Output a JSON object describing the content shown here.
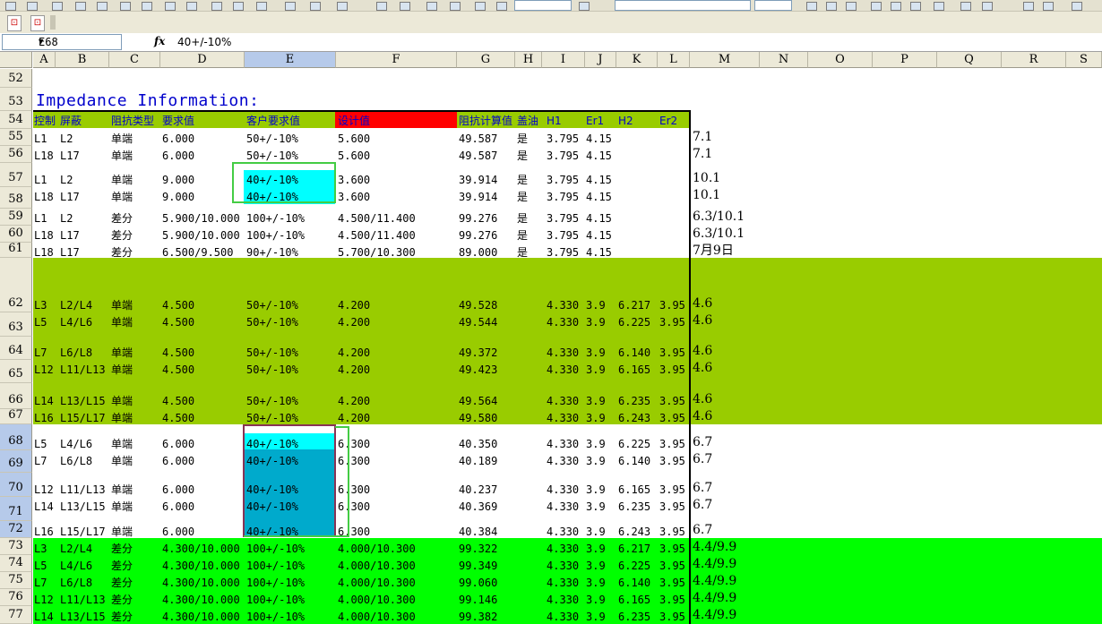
{
  "name_box": "E68",
  "formula_bar": "40+/-10%",
  "columns": [
    "A",
    "B",
    "C",
    "D",
    "E",
    "F",
    "G",
    "H",
    "I",
    "J",
    "K",
    "L",
    "M",
    "N",
    "O",
    "P",
    "Q",
    "R",
    "S"
  ],
  "rows": [
    "52",
    "53",
    "54",
    "55",
    "56",
    "57",
    "58",
    "59",
    "60",
    "61",
    "62",
    "63",
    "64",
    "65",
    "66",
    "67",
    "68",
    "69",
    "70",
    "71",
    "72",
    "73",
    "74",
    "75",
    "76",
    "77"
  ],
  "title": "Impedance Information:",
  "header": {
    "control": "控制",
    "shield": "屏蔽",
    "type": "阻抗类型",
    "requirement": "要求值",
    "customer": "客户要求值",
    "design": "设计值",
    "calc": "阻抗计算值",
    "oil": "盖油",
    "h1": "H1",
    "er1": "Er1",
    "h2": "H2",
    "er2": "Er2"
  },
  "data_rows": [
    {
      "row": "55",
      "a": "L1",
      "b": "L2",
      "c": "单端",
      "d": "6.000",
      "e": "50+/-10%",
      "f": "5.600",
      "g": "49.587",
      "h": "是",
      "i": "3.795",
      "j": "4.15",
      "k": "",
      "l": "",
      "m": "7.1"
    },
    {
      "row": "56",
      "a": "L18",
      "b": "L17",
      "c": "单端",
      "d": "6.000",
      "e": "50+/-10%",
      "f": "5.600",
      "g": "49.587",
      "h": "是",
      "i": "3.795",
      "j": "4.15",
      "k": "",
      "l": "",
      "m": "7.1"
    },
    {
      "row": "57",
      "a": "L1",
      "b": "L2",
      "c": "单端",
      "d": "9.000",
      "e": "40+/-10%",
      "f": "3.600",
      "g": "39.914",
      "h": "是",
      "i": "3.795",
      "j": "4.15",
      "k": "",
      "l": "",
      "m": "10.1"
    },
    {
      "row": "58",
      "a": "L18",
      "b": "L17",
      "c": "单端",
      "d": "9.000",
      "e": "40+/-10%",
      "f": "3.600",
      "g": "39.914",
      "h": "是",
      "i": "3.795",
      "j": "4.15",
      "k": "",
      "l": "",
      "m": "10.1"
    },
    {
      "row": "59",
      "a": "L1",
      "b": "L2",
      "c": "差分",
      "d": "5.900/10.000",
      "e": "100+/-10%",
      "f": "4.500/11.400",
      "g": "99.276",
      "h": "是",
      "i": "3.795",
      "j": "4.15",
      "k": "",
      "l": "",
      "m": "6.3/10.1"
    },
    {
      "row": "60",
      "a": "L18",
      "b": "L17",
      "c": "差分",
      "d": "5.900/10.000",
      "e": "100+/-10%",
      "f": "4.500/11.400",
      "g": "99.276",
      "h": "是",
      "i": "3.795",
      "j": "4.15",
      "k": "",
      "l": "",
      "m": "6.3/10.1"
    },
    {
      "row": "61",
      "a": "L18",
      "b": "L17",
      "c": "差分",
      "d": "6.500/9.500",
      "e": "90+/-10%",
      "f": "5.700/10.300",
      "g": "89.000",
      "h": "是",
      "i": "3.795",
      "j": "4.15",
      "k": "",
      "l": "",
      "m": "7月9日"
    },
    {
      "row": "62",
      "a": "L3",
      "b": "L2/L4",
      "c": "单端",
      "d": "4.500",
      "e": "50+/-10%",
      "f": "4.200",
      "g": "49.528",
      "h": "",
      "i": "4.330",
      "j": "3.9",
      "k": "6.217",
      "l": "3.95",
      "m": "4.6"
    },
    {
      "row": "63",
      "a": "L5",
      "b": "L4/L6",
      "c": "单端",
      "d": "4.500",
      "e": "50+/-10%",
      "f": "4.200",
      "g": "49.544",
      "h": "",
      "i": "4.330",
      "j": "3.9",
      "k": "6.225",
      "l": "3.95",
      "m": "4.6"
    },
    {
      "row": "64",
      "a": "L7",
      "b": "L6/L8",
      "c": "单端",
      "d": "4.500",
      "e": "50+/-10%",
      "f": "4.200",
      "g": "49.372",
      "h": "",
      "i": "4.330",
      "j": "3.9",
      "k": "6.140",
      "l": "3.95",
      "m": "4.6"
    },
    {
      "row": "65",
      "a": "L12",
      "b": "L11/L13",
      "c": "单端",
      "d": "4.500",
      "e": "50+/-10%",
      "f": "4.200",
      "g": "49.423",
      "h": "",
      "i": "4.330",
      "j": "3.9",
      "k": "6.165",
      "l": "3.95",
      "m": "4.6"
    },
    {
      "row": "66",
      "a": "L14",
      "b": "L13/L15",
      "c": "单端",
      "d": "4.500",
      "e": "50+/-10%",
      "f": "4.200",
      "g": "49.564",
      "h": "",
      "i": "4.330",
      "j": "3.9",
      "k": "6.235",
      "l": "3.95",
      "m": "4.6"
    },
    {
      "row": "67",
      "a": "L16",
      "b": "L15/L17",
      "c": "单端",
      "d": "4.500",
      "e": "50+/-10%",
      "f": "4.200",
      "g": "49.580",
      "h": "",
      "i": "4.330",
      "j": "3.9",
      "k": "6.243",
      "l": "3.95",
      "m": "4.6"
    },
    {
      "row": "68",
      "a": "L5",
      "b": "L4/L6",
      "c": "单端",
      "d": "6.000",
      "e": "40+/-10%",
      "f": "6.300",
      "g": "40.350",
      "h": "",
      "i": "4.330",
      "j": "3.9",
      "k": "6.225",
      "l": "3.95",
      "m": "6.7"
    },
    {
      "row": "69",
      "a": "L7",
      "b": "L6/L8",
      "c": "单端",
      "d": "6.000",
      "e": "40+/-10%",
      "f": "6.300",
      "g": "40.189",
      "h": "",
      "i": "4.330",
      "j": "3.9",
      "k": "6.140",
      "l": "3.95",
      "m": "6.7"
    },
    {
      "row": "70",
      "a": "L12",
      "b": "L11/L13",
      "c": "单端",
      "d": "6.000",
      "e": "40+/-10%",
      "f": "6.300",
      "g": "40.237",
      "h": "",
      "i": "4.330",
      "j": "3.9",
      "k": "6.165",
      "l": "3.95",
      "m": "6.7"
    },
    {
      "row": "71",
      "a": "L14",
      "b": "L13/L15",
      "c": "单端",
      "d": "6.000",
      "e": "40+/-10%",
      "f": "6.300",
      "g": "40.369",
      "h": "",
      "i": "4.330",
      "j": "3.9",
      "k": "6.235",
      "l": "3.95",
      "m": "6.7"
    },
    {
      "row": "72",
      "a": "L16",
      "b": "L15/L17",
      "c": "单端",
      "d": "6.000",
      "e": "40+/-10%",
      "f": "6.300",
      "g": "40.384",
      "h": "",
      "i": "4.330",
      "j": "3.9",
      "k": "6.243",
      "l": "3.95",
      "m": "6.7"
    },
    {
      "row": "73",
      "a": "L3",
      "b": "L2/L4",
      "c": "差分",
      "d": "4.300/10.000",
      "e": "100+/-10%",
      "f": "4.000/10.300",
      "g": "99.322",
      "h": "",
      "i": "4.330",
      "j": "3.9",
      "k": "6.217",
      "l": "3.95",
      "m": "4.4/9.9"
    },
    {
      "row": "74",
      "a": "L5",
      "b": "L4/L6",
      "c": "差分",
      "d": "4.300/10.000",
      "e": "100+/-10%",
      "f": "4.000/10.300",
      "g": "99.349",
      "h": "",
      "i": "4.330",
      "j": "3.9",
      "k": "6.225",
      "l": "3.95",
      "m": "4.4/9.9"
    },
    {
      "row": "75",
      "a": "L7",
      "b": "L6/L8",
      "c": "差分",
      "d": "4.300/10.000",
      "e": "100+/-10%",
      "f": "4.000/10.300",
      "g": "99.060",
      "h": "",
      "i": "4.330",
      "j": "3.9",
      "k": "6.140",
      "l": "3.95",
      "m": "4.4/9.9"
    },
    {
      "row": "76",
      "a": "L12",
      "b": "L11/L13",
      "c": "差分",
      "d": "4.300/10.000",
      "e": "100+/-10%",
      "f": "4.000/10.300",
      "g": "99.146",
      "h": "",
      "i": "4.330",
      "j": "3.9",
      "k": "6.165",
      "l": "3.95",
      "m": "4.4/9.9"
    },
    {
      "row": "77",
      "a": "L14",
      "b": "L13/L15",
      "c": "差分",
      "d": "4.300/10.000",
      "e": "100+/-10%",
      "f": "4.000/10.300",
      "g": "99.382",
      "h": "",
      "i": "4.330",
      "j": "3.9",
      "k": "6.235",
      "l": "3.95",
      "m": "4.4/9.9"
    }
  ],
  "colors": {
    "olive": "#99cc00",
    "bright_green": "#00ff00",
    "cyan": "#00ffff",
    "teal": "#00aacc",
    "red_header": "#ff0000",
    "header_text": "#0000cc"
  }
}
